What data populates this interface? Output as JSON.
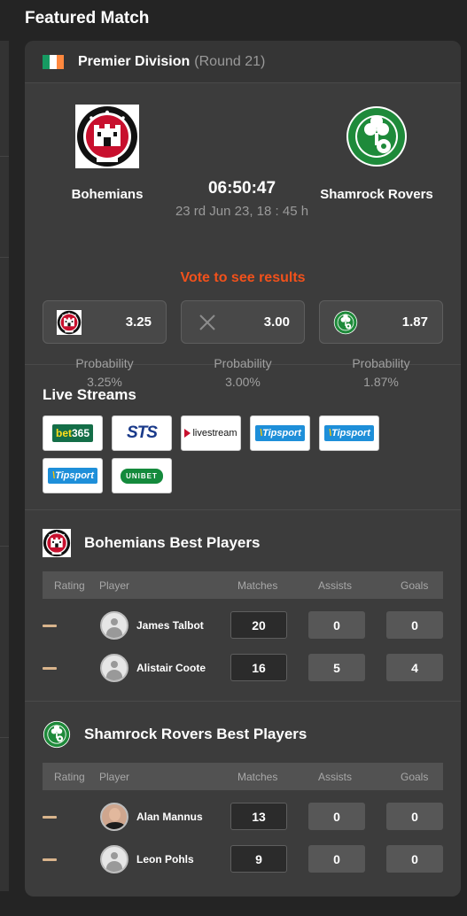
{
  "page": {
    "title": "Featured Match"
  },
  "league": {
    "name": "Premier Division",
    "round": "(Round 21)",
    "flag_colors": [
      "#169b62",
      "#ffffff",
      "#ff883e"
    ]
  },
  "match": {
    "home": {
      "name": "Bohemians",
      "logo": "bohemians-crest-icon"
    },
    "away": {
      "name": "Shamrock Rovers",
      "logo": "shamrock-rovers-crest-icon"
    },
    "countdown": "06:50:47",
    "date": "23 rd Jun 23, 18 : 45 h",
    "vote_text": "Vote to see results",
    "vote_color": "#f2511b",
    "odds": [
      {
        "icon": "bohemians-crest-icon",
        "value": "3.25",
        "prob_label": "Probability",
        "prob_value": "3.25%"
      },
      {
        "icon": "draw-x-icon",
        "value": "3.00",
        "prob_label": "Probability",
        "prob_value": "3.00%"
      },
      {
        "icon": "shamrock-rovers-crest-icon",
        "value": "1.87",
        "prob_label": "Probability",
        "prob_value": "1.87%"
      }
    ]
  },
  "streams": {
    "title": "Live Streams",
    "items": [
      {
        "name": "bet365",
        "a": "bet",
        "b": "365"
      },
      {
        "name": "STS",
        "text": "STS"
      },
      {
        "name": "livestream",
        "text": "livestream"
      },
      {
        "name": "Tipsport",
        "mark": "\\",
        "text": "Tipsport"
      },
      {
        "name": "Tipsport",
        "mark": "\\",
        "text": "Tipsport"
      },
      {
        "name": "Tipsport",
        "mark": "\\",
        "text": "Tipsport"
      },
      {
        "name": "Unibet",
        "text": "UNIBET"
      }
    ]
  },
  "columns": {
    "rating": "Rating",
    "player": "Player",
    "matches": "Matches",
    "assists": "Assists",
    "goals": "Goals"
  },
  "home_players": {
    "title": "Bohemians Best Players",
    "rows": [
      {
        "name": "James Talbot",
        "matches": "20",
        "assists": "0",
        "goals": "0"
      },
      {
        "name": "Alistair Coote",
        "matches": "16",
        "assists": "5",
        "goals": "4"
      }
    ]
  },
  "away_players": {
    "title": "Shamrock Rovers Best Players",
    "rows": [
      {
        "name": "Alan Mannus",
        "matches": "13",
        "assists": "0",
        "goals": "0"
      },
      {
        "name": "Leon Pohls",
        "matches": "9",
        "assists": "0",
        "goals": "0"
      }
    ]
  }
}
